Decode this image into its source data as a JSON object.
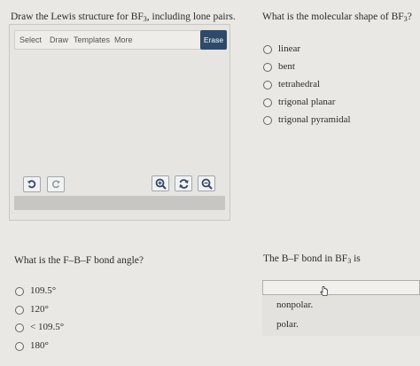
{
  "q1": {
    "title_pre": "Draw the Lewis structure for BF",
    "title_sub": "3",
    "title_post": ", including lone pairs.",
    "toolbar": {
      "select": "Select",
      "draw": "Draw",
      "templates": "Templates",
      "more": "More",
      "erase": "Erase"
    },
    "icons": [
      "undo-icon",
      "redo-icon",
      "zoom-in-icon",
      "reset-zoom-icon",
      "zoom-out-icon"
    ]
  },
  "q2": {
    "title_pre": "What is the molecular shape of BF",
    "title_sub": "3",
    "title_post": "?",
    "options": [
      "linear",
      "bent",
      "tetrahedral",
      "trigonal planar",
      "trigonal pyramidal"
    ]
  },
  "q3": {
    "title": "What is the F–B–F bond angle?",
    "options": [
      "109.5°",
      "120°",
      "< 109.5°",
      "180°"
    ]
  },
  "q4": {
    "title_pre": "The B–F bond in BF",
    "title_sub": "3",
    "title_post": " is",
    "dropdown_options": [
      "nonpolar.",
      "polar."
    ]
  },
  "colors": {
    "erase_button": "#2e4a6a",
    "background": "#e9e8e4"
  }
}
